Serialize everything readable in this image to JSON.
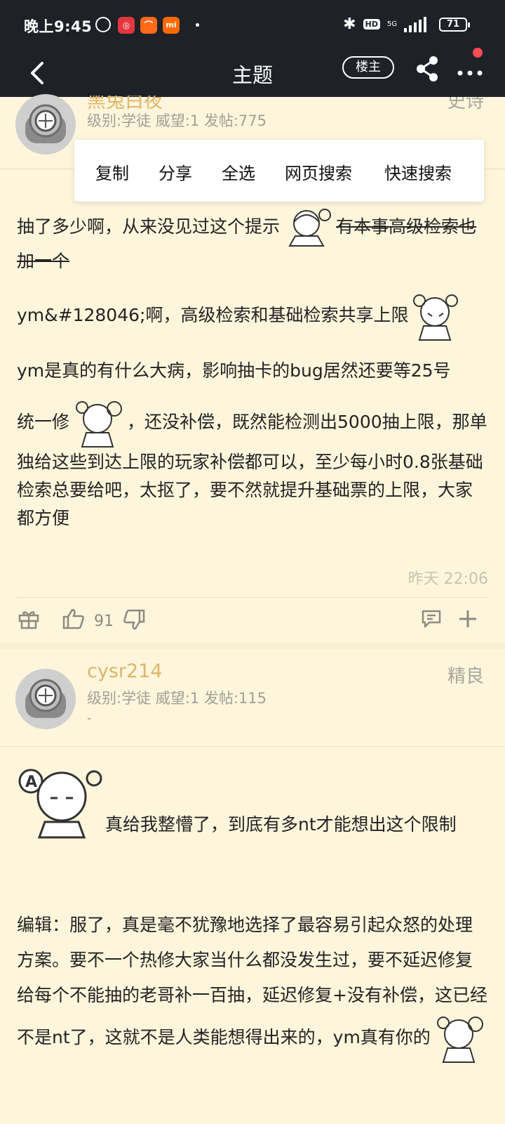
{
  "status_bar": {
    "time": "晚上9:45",
    "apps": [
      "网易云音乐",
      "小米",
      "mi"
    ],
    "network": "5G",
    "battery": "71"
  },
  "header": {
    "title": "主题",
    "louzhu_label": "楼主"
  },
  "context_menu": [
    "复制",
    "分享",
    "全选",
    "网页搜索",
    "快速搜索"
  ],
  "posts": [
    {
      "username": "黑兔白夜",
      "info": "级别:学徒 威望:1 发帖:775",
      "tag": "史诗",
      "paragraphs": {
        "p1_text": "抽了多少啊，从来没见过这个提示",
        "p1_strike": "有本事高级检索也加一个",
        "p2": "ym&#128046;啊，高级检索和基础检索共享上限",
        "p3_a": "ym是真的有什么大病，影响抽卡的bug居然还要等25号",
        "p3_b": "统一修",
        "p3_c": "，还没补偿，既然能检测出5000抽上限，那单独给这些到达上限的玩家补偿都可以，至少每小时0.8张基础检索总要给吧，太抠了，要不然就提升基础票的上限，大家都方便"
      },
      "time": "昨天 22:06",
      "likes": "91"
    },
    {
      "username": "cysr214",
      "info": "级别:学徒 威望:1 发帖:115",
      "sub": "-",
      "tag": "精良",
      "paragraphs": {
        "p1": "真给我整懵了，到底有多nt才能想出这个限制",
        "p2": "编辑：服了，真是毫不犹豫地选择了最容易引起众怒的处理方案。要不一个热修大家当什么都没发生过，要不延迟修复给每个不能抽的老哥补一百抽，延迟修复+没有补偿，这已经不是nt了，这就不是人类能想得出来的，ym真有你的"
      }
    }
  ],
  "colors": {
    "bar": "#1f2128",
    "background": "#fdf6dc",
    "username": "#e0b56a",
    "accent_dot": "#ff4b57"
  }
}
